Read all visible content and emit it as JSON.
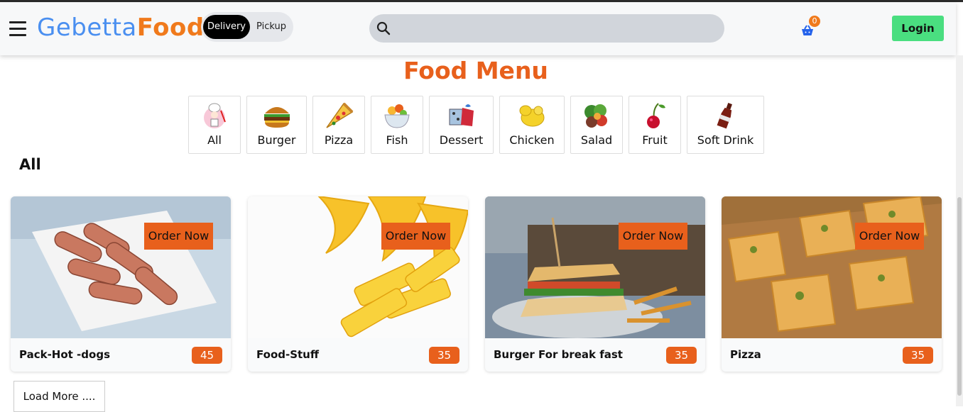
{
  "header": {
    "brand_part1": "Gebetta",
    "brand_part2": "Foods",
    "toggle": {
      "delivery": "Delivery",
      "pickup": "Pickup"
    },
    "search": {
      "placeholder": ""
    },
    "cart": {
      "count": "0"
    },
    "login": "Login"
  },
  "menu": {
    "title": "Food Menu",
    "categories": [
      {
        "label": "All",
        "icon": "chef-icon"
      },
      {
        "label": "Burger",
        "icon": "burger-icon"
      },
      {
        "label": "Pizza",
        "icon": "pizza-slice-icon"
      },
      {
        "label": "Fish",
        "icon": "fish-bowl-icon"
      },
      {
        "label": "Dessert",
        "icon": "dessert-gift-icon"
      },
      {
        "label": "Chicken",
        "icon": "chicken-icon"
      },
      {
        "label": "Salad",
        "icon": "salad-icon"
      },
      {
        "label": "Fruit",
        "icon": "cherry-icon"
      },
      {
        "label": "Soft Drink",
        "icon": "soda-bottle-icon"
      }
    ],
    "section_title": "All"
  },
  "products": [
    {
      "name": "Pack-Hot -dogs",
      "price": "45",
      "order_label": "Order Now"
    },
    {
      "name": "Food-Stuff",
      "price": "35",
      "order_label": "Order Now"
    },
    {
      "name": "Burger For break fast",
      "price": "35",
      "order_label": "Order Now"
    },
    {
      "name": "Pizza",
      "price": "35",
      "order_label": "Order Now"
    }
  ],
  "load_more": "Load More ....",
  "colors": {
    "accent": "#e8601c",
    "brand_blue": "#4a8ff0",
    "login_green": "#4ade80"
  }
}
